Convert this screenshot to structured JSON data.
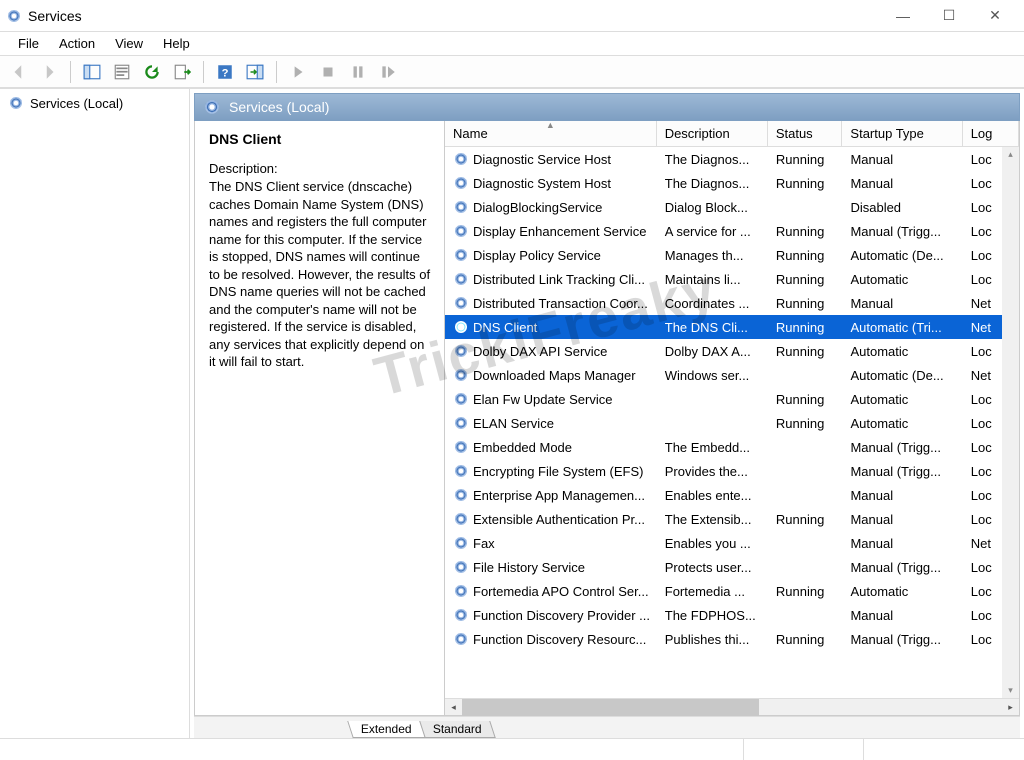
{
  "window": {
    "title": "Services"
  },
  "menu": {
    "file": "File",
    "action": "Action",
    "view": "View",
    "help": "Help"
  },
  "tree": {
    "root": "Services (Local)"
  },
  "panel": {
    "heading": "Services (Local)"
  },
  "info": {
    "title": "DNS Client",
    "description_label": "Description:",
    "description": "The DNS Client service (dnscache) caches Domain Name System (DNS) names and registers the full computer name for this computer. If the service is stopped, DNS names will continue to be resolved. However, the results of DNS name queries will not be cached and the computer's name will not be registered. If the service is disabled, any services that explicitly depend on it will fail to start."
  },
  "columns": {
    "name": "Name",
    "description": "Description",
    "status": "Status",
    "startup": "Startup Type",
    "logon": "Log"
  },
  "rows": [
    {
      "name": "Diagnostic Service Host",
      "desc": "The Diagnos...",
      "status": "Running",
      "startup": "Manual",
      "logon": "Loc"
    },
    {
      "name": "Diagnostic System Host",
      "desc": "The Diagnos...",
      "status": "Running",
      "startup": "Manual",
      "logon": "Loc"
    },
    {
      "name": "DialogBlockingService",
      "desc": "Dialog Block...",
      "status": "",
      "startup": "Disabled",
      "logon": "Loc"
    },
    {
      "name": "Display Enhancement Service",
      "desc": "A service for ...",
      "status": "Running",
      "startup": "Manual (Trigg...",
      "logon": "Loc"
    },
    {
      "name": "Display Policy Service",
      "desc": "Manages th...",
      "status": "Running",
      "startup": "Automatic (De...",
      "logon": "Loc"
    },
    {
      "name": "Distributed Link Tracking Cli...",
      "desc": "Maintains li...",
      "status": "Running",
      "startup": "Automatic",
      "logon": "Loc"
    },
    {
      "name": "Distributed Transaction Coor...",
      "desc": "Coordinates ...",
      "status": "Running",
      "startup": "Manual",
      "logon": "Net"
    },
    {
      "name": "DNS Client",
      "desc": "The DNS Cli...",
      "status": "Running",
      "startup": "Automatic (Tri...",
      "logon": "Net",
      "selected": true
    },
    {
      "name": "Dolby DAX API Service",
      "desc": "Dolby DAX A...",
      "status": "Running",
      "startup": "Automatic",
      "logon": "Loc"
    },
    {
      "name": "Downloaded Maps Manager",
      "desc": "Windows ser...",
      "status": "",
      "startup": "Automatic (De...",
      "logon": "Net"
    },
    {
      "name": "Elan Fw Update Service",
      "desc": "",
      "status": "Running",
      "startup": "Automatic",
      "logon": "Loc"
    },
    {
      "name": "ELAN Service",
      "desc": "",
      "status": "Running",
      "startup": "Automatic",
      "logon": "Loc"
    },
    {
      "name": "Embedded Mode",
      "desc": "The Embedd...",
      "status": "",
      "startup": "Manual (Trigg...",
      "logon": "Loc"
    },
    {
      "name": "Encrypting File System (EFS)",
      "desc": "Provides the...",
      "status": "",
      "startup": "Manual (Trigg...",
      "logon": "Loc"
    },
    {
      "name": "Enterprise App Managemen...",
      "desc": "Enables ente...",
      "status": "",
      "startup": "Manual",
      "logon": "Loc"
    },
    {
      "name": "Extensible Authentication Pr...",
      "desc": "The Extensib...",
      "status": "Running",
      "startup": "Manual",
      "logon": "Loc"
    },
    {
      "name": "Fax",
      "desc": "Enables you ...",
      "status": "",
      "startup": "Manual",
      "logon": "Net"
    },
    {
      "name": "File History Service",
      "desc": "Protects user...",
      "status": "",
      "startup": "Manual (Trigg...",
      "logon": "Loc"
    },
    {
      "name": "Fortemedia APO Control Ser...",
      "desc": "Fortemedia ...",
      "status": "Running",
      "startup": "Automatic",
      "logon": "Loc"
    },
    {
      "name": "Function Discovery Provider ...",
      "desc": "The FDPHOS...",
      "status": "",
      "startup": "Manual",
      "logon": "Loc"
    },
    {
      "name": "Function Discovery Resourc...",
      "desc": "Publishes thi...",
      "status": "Running",
      "startup": "Manual (Trigg...",
      "logon": "Loc"
    }
  ],
  "tabs": {
    "extended": "Extended",
    "standard": "Standard"
  },
  "watermark": "TrickiFreaky"
}
